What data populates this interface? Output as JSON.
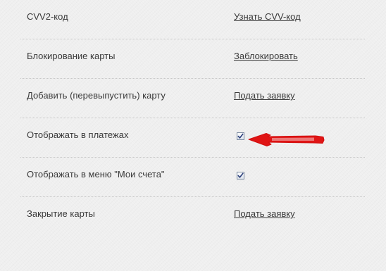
{
  "settings": {
    "rows": [
      {
        "label": "CVV2-код",
        "action_type": "link",
        "action_label": "Узнать CVV-код"
      },
      {
        "label": "Блокирование карты",
        "action_type": "link",
        "action_label": "Заблокировать"
      },
      {
        "label": "Добавить (перевыпустить) карту",
        "action_type": "link",
        "action_label": "Подать заявку"
      },
      {
        "label": "Отображать в платежах",
        "action_type": "checkbox",
        "checked": true
      },
      {
        "label": "Отображать в меню \"Мои счета\"",
        "action_type": "checkbox",
        "checked": true
      },
      {
        "label": "Закрытие карты",
        "action_type": "link",
        "action_label": "Подать заявку"
      }
    ]
  },
  "annotation": {
    "arrow_color": "#e01515",
    "points_to": "Отображать в платежах"
  },
  "colors": {
    "text": "#3a3a3a",
    "background": "#efefef",
    "divider": "#c7c7c7",
    "checkmark": "#2b3f7a"
  }
}
